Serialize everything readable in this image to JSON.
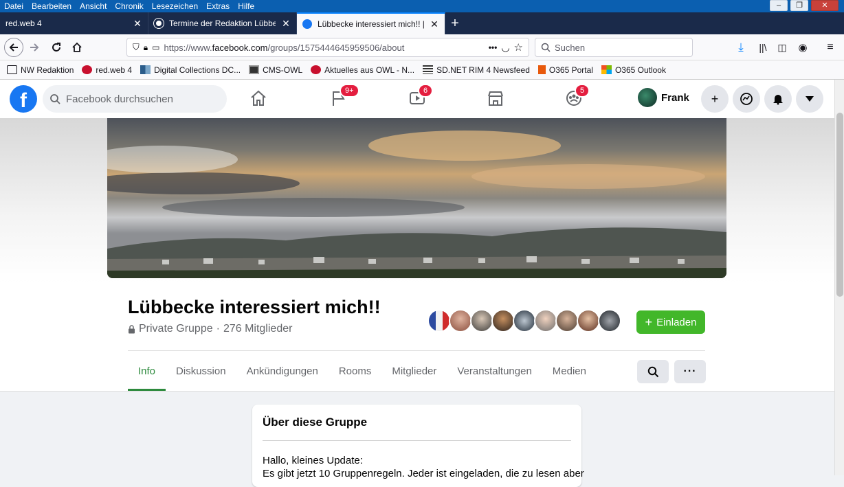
{
  "menubar": {
    "items": [
      "Datei",
      "Bearbeiten",
      "Ansicht",
      "Chronik",
      "Lesezeichen",
      "Extras",
      "Hilfe"
    ]
  },
  "tabs": [
    {
      "title": "red.web 4",
      "active": false
    },
    {
      "title": "Termine der Redaktion Lübbecke",
      "active": false
    },
    {
      "title": "Lübbecke interessiert mich!! | F",
      "active": true
    }
  ],
  "navbar": {
    "url_prefix": "https://www.",
    "url_domain": "facebook.com",
    "url_path": "/groups/1575444645959506/about",
    "search_placeholder": "Suchen"
  },
  "bookmarks": [
    {
      "label": "NW Redaktion",
      "icon": "folder-icon"
    },
    {
      "label": "red.web 4",
      "icon": "nw-icon"
    },
    {
      "label": "Digital Collections DC...",
      "icon": "dc-icon"
    },
    {
      "label": "CMS-OWL",
      "icon": "cms-icon"
    },
    {
      "label": "Aktuelles aus OWL - N...",
      "icon": "nw-icon"
    },
    {
      "label": "SD.NET RIM 4 Newsfeed",
      "icon": "feed-icon"
    },
    {
      "label": "O365 Portal",
      "icon": "office-icon"
    },
    {
      "label": "O365 Outlook",
      "icon": "windows-icon"
    }
  ],
  "facebook": {
    "search_placeholder": "Facebook durchsuchen",
    "badges": {
      "pages": "9+",
      "watch": "6",
      "groups": "5"
    },
    "profile_name": "Frank",
    "accent": "#1877f2"
  },
  "group": {
    "name": "Lübbecke interessiert mich!!",
    "privacy": "Private Gruppe",
    "separator": "·",
    "members": "276 Mitglieder",
    "invite_label": "Einladen",
    "invite_color": "#42b72a",
    "tabs": [
      "Info",
      "Diskussion",
      "Ankündigungen",
      "Rooms",
      "Mitglieder",
      "Veranstaltungen",
      "Medien"
    ],
    "active_tab": "Info",
    "tab_accent": "#2d8a3d"
  },
  "about": {
    "title": "Über diese Gruppe",
    "line1": "Hallo, kleines Update:",
    "line2": "Es gibt jetzt 10 Gruppenregeln. Jeder ist eingeladen, die zu lesen aber"
  }
}
